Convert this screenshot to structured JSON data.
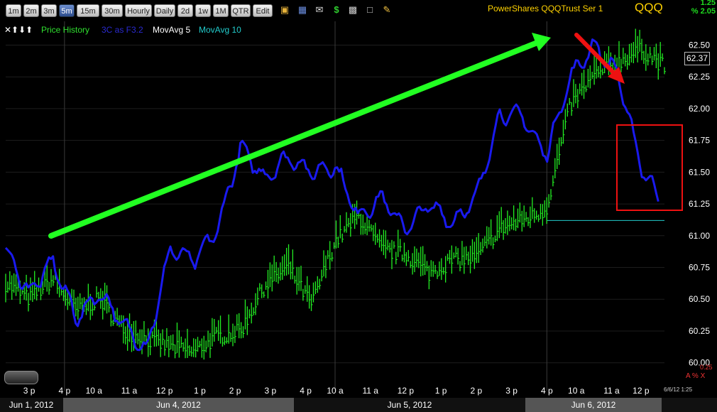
{
  "toolbar": {
    "timeframes": [
      "1m",
      "2m",
      "3m",
      "5m",
      "15m",
      "30m",
      "Hourly",
      "Daily",
      "2d",
      "1w",
      "1M",
      "QTR",
      "Edit"
    ],
    "active_timeframe": "5m",
    "icons": [
      "lock-icon",
      "save-icon",
      "email-icon",
      "dollar-icon",
      "print-icon",
      "window-icon",
      "pencil-icon"
    ],
    "ticker_name": "PowerShares QQQTrust Ser 1",
    "ticker_symbol": "QQQ",
    "change_abs": "1.25",
    "change_pct": "% 2.05"
  },
  "legend": {
    "arrows": "✕⬆⬇⬆",
    "price_history": "Price History",
    "indicator": "3C as F3.2",
    "mov_avg_5": "MovAvg 5",
    "mov_avg_10": "MovAvg 10"
  },
  "current_price": "62.37",
  "timestamp": "6/6/12 1:25",
  "small_value": "0.25",
  "small_controls": "A % X",
  "date_bar": [
    "Jun 1, 2012",
    "Jun 4, 2012",
    "Jun 5, 2012",
    "Jun 6, 2012"
  ],
  "colors": {
    "price_bars": "#22ee22",
    "indicator_line": "#1a1aee",
    "annotation_green": "#22ff22",
    "annotation_red": "#ee1111",
    "ticker_text": "#ffd200",
    "mov_avg_10": "#22cccc"
  },
  "chart_data": {
    "type": "line",
    "ylim": [
      59.92,
      62.62
    ],
    "yticks": [
      62.5,
      62.25,
      62.0,
      61.75,
      61.5,
      61.25,
      61.0,
      60.75,
      60.5,
      60.25,
      60.0
    ],
    "ytick_labels": [
      "62.50",
      "62.25",
      "62.00",
      "61.75",
      "61.50",
      "61.25",
      "61.00",
      "60.75",
      "60.50",
      "60.25",
      "60.00"
    ],
    "x_ticks": [
      "3 p",
      "4 p",
      "10 a",
      "11 a",
      "12 p",
      "1 p",
      "2 p",
      "3 p",
      "4 p",
      "10 a",
      "11 a",
      "12 p",
      "1 p",
      "2 p",
      "3 p",
      "4 p",
      "10 a",
      "11 a",
      "12 p"
    ],
    "x_count": 112,
    "x_tick_index": [
      4,
      10,
      15,
      21,
      27,
      33,
      39,
      45,
      51,
      56,
      62,
      68,
      74,
      80,
      86,
      92,
      97,
      103,
      108
    ],
    "session_breaks": [
      10,
      56,
      92
    ],
    "reference_level": 61.12,
    "series": [
      {
        "kind": "bars",
        "x": [
          0,
          4,
          8,
          12,
          16,
          20,
          24,
          28,
          32,
          36,
          40,
          44,
          48,
          52,
          56,
          60,
          64,
          68,
          72,
          76,
          80,
          84,
          88,
          91,
          92,
          96,
          100,
          104,
          108,
          112
        ],
        "close": [
          60.62,
          60.5,
          60.65,
          60.4,
          60.5,
          60.25,
          60.18,
          60.12,
          60.08,
          60.2,
          60.25,
          60.6,
          60.75,
          60.45,
          60.95,
          61.15,
          60.88,
          60.85,
          60.7,
          60.8,
          60.82,
          61.05,
          61.12,
          61.18,
          61.22,
          62.02,
          62.25,
          62.36,
          62.46,
          62.33
        ]
      },
      {
        "kind": "line",
        "x": [
          0,
          4,
          8,
          12,
          16,
          20,
          24,
          28,
          32,
          36,
          40,
          44,
          48,
          52,
          56,
          60,
          64,
          68,
          72,
          76,
          80,
          84,
          88,
          90,
          92,
          96,
          100,
          104,
          108,
          111
        ],
        "value": [
          60.88,
          60.55,
          60.8,
          60.35,
          60.55,
          60.3,
          60.1,
          60.9,
          60.8,
          61.05,
          61.7,
          61.45,
          61.62,
          61.5,
          61.55,
          61.15,
          61.3,
          61.05,
          61.25,
          61.1,
          61.3,
          61.95,
          61.95,
          61.75,
          61.65,
          62.25,
          62.5,
          62.28,
          61.55,
          61.3
        ]
      }
    ]
  }
}
